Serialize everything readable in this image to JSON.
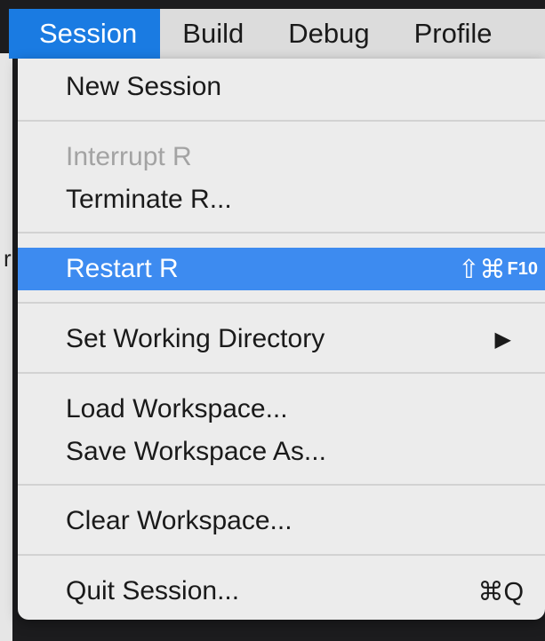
{
  "menubar": {
    "items": [
      {
        "label": "Session",
        "active": true
      },
      {
        "label": "Build"
      },
      {
        "label": "Debug"
      },
      {
        "label": "Profile"
      }
    ]
  },
  "session_menu": {
    "new_session": "New Session",
    "interrupt_r": "Interrupt R",
    "terminate_r": "Terminate R...",
    "restart_r": "Restart R",
    "restart_r_shortcut": "⇧⌘",
    "restart_r_shortcut_key": "F10",
    "set_working_directory": "Set Working Directory",
    "set_working_directory_arrow": "▶",
    "load_workspace": "Load Workspace...",
    "save_workspace_as": "Save Workspace As...",
    "clear_workspace": "Clear Workspace...",
    "quit_session": "Quit Session...",
    "quit_session_shortcut": "⌘Q"
  },
  "colors": {
    "menubar_active": "#1a7be2",
    "item_highlight": "#3d8bf0",
    "disabled_text": "#a3a3a3",
    "menu_background": "#ececec"
  }
}
